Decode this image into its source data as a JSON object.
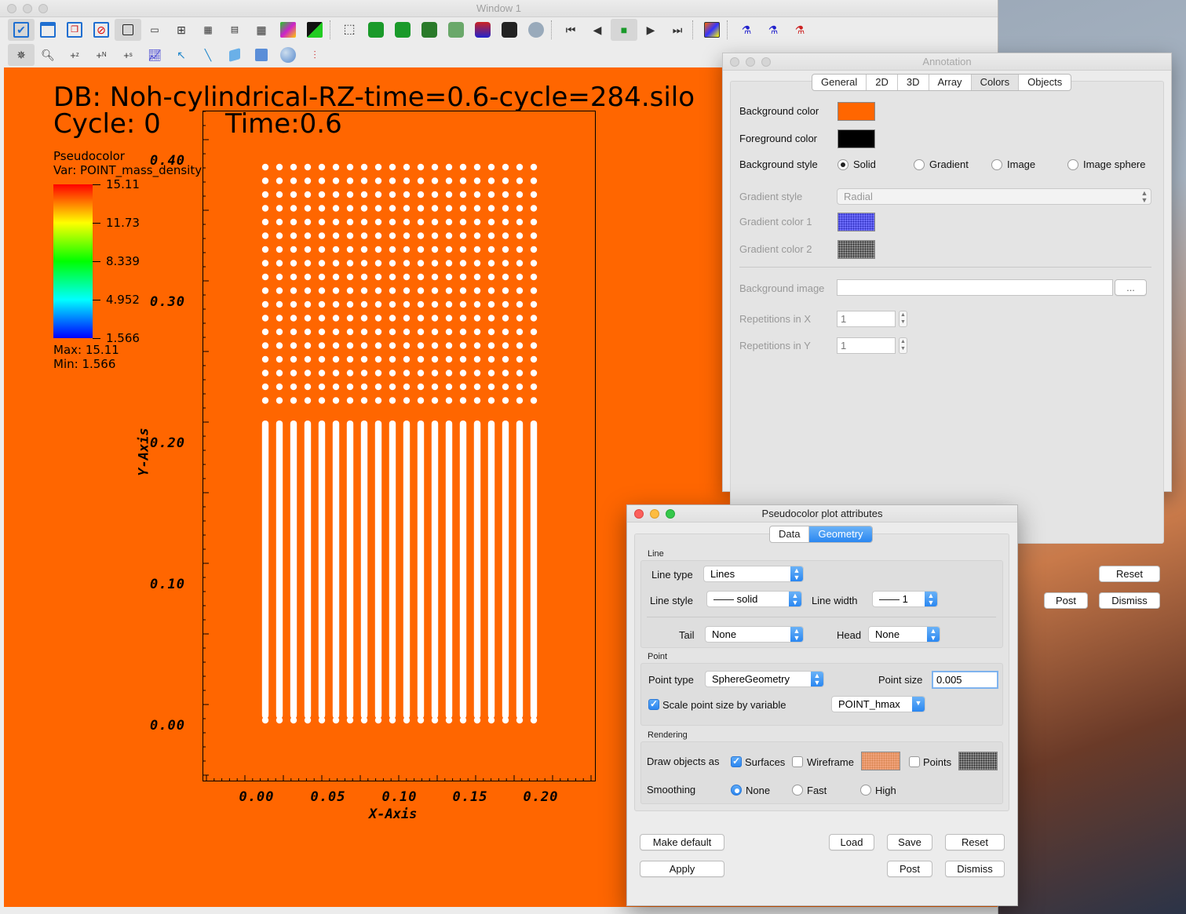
{
  "main_window": {
    "title": "Window 1",
    "toolbar1": [
      "check-doc-icon",
      "new-window-icon",
      "clone-window-icon",
      "delete-window-icon",
      "layout-1x1-icon",
      "layout-1x2-icon",
      "layout-2x2-icon",
      "layout-2x3-icon",
      "layout-2x4-icon",
      "layout-3x3-icon",
      "color-cube-icon",
      "lock-icon",
      "perspective-box-icon",
      "camera-1-icon",
      "camera-2-icon",
      "camera-3-icon",
      "camera-4-icon",
      "camera-5-icon",
      "camera-6-icon",
      "globe-icon",
      "first-frame-icon",
      "prev-frame-icon",
      "stop-icon",
      "play-icon",
      "last-frame-icon",
      "image-icon",
      "spinner-icon",
      "spinner2-icon",
      "spinner3-icon"
    ],
    "toolbar2": [
      "navigate-icon",
      "zoom-icon",
      "zone-pick-icon",
      "node-pick-icon",
      "spreadsheet-pick-icon",
      "lineout-icon",
      "pick-arrow-icon",
      "line-icon",
      "plane-icon",
      "box-icon",
      "sphere-icon",
      "sliders-icon"
    ]
  },
  "viz": {
    "db_title": "DB: Noh-cylindrical-RZ-time=0.6-cycle=284.silo",
    "cycle": "Cycle: 0",
    "time": "Time:0.6",
    "legend": {
      "name": "Pseudocolor",
      "var": "Var: POINT_mass_density",
      "values": [
        "15.11",
        "11.73",
        "8.339",
        "4.952",
        "1.566"
      ],
      "max": "Max:  15.11",
      "min": "Min:  1.566"
    },
    "y_ticks": [
      "0.40",
      "0.30",
      "0.20",
      "0.10",
      "0.00"
    ],
    "x_ticks": [
      "0.00",
      "0.05",
      "0.10",
      "0.15",
      "0.20"
    ],
    "y_axis_title": "Y-Axis",
    "x_axis_title": "X-Axis",
    "background_color": "#ff6600"
  },
  "annotation": {
    "title": "Annotation",
    "tabs": [
      "General",
      "2D",
      "3D",
      "Array",
      "Colors",
      "Objects"
    ],
    "active_tab": "Colors",
    "background_color_label": "Background color",
    "foreground_color_label": "Foreground color",
    "background_style_label": "Background style",
    "style_options": [
      "Solid",
      "Gradient",
      "Image",
      "Image sphere"
    ],
    "gradient_style_label": "Gradient style",
    "gradient_style_value": "Radial",
    "gradient_color1_label": "Gradient color 1",
    "gradient_color2_label": "Gradient color 2",
    "background_image_label": "Background image",
    "browse_label": "...",
    "rep_x_label": "Repetitions in X",
    "rep_x_value": "1",
    "rep_y_label": "Repetitions in Y",
    "rep_y_value": "1",
    "reset_label": "Reset",
    "post_label": "Post",
    "dismiss_label": "Dismiss",
    "background_color": "#ff6600",
    "foreground_color": "#000000"
  },
  "pseudocolor": {
    "title": "Pseudocolor plot attributes",
    "tabs": [
      "Data",
      "Geometry"
    ],
    "active_tab": "Geometry",
    "line_group": "Line",
    "line_type_label": "Line type",
    "line_type_value": "Lines",
    "line_style_label": "Line style",
    "line_style_value": "—— solid",
    "line_width_label": "Line width",
    "line_width_value": "—— 1",
    "tail_label": "Tail",
    "tail_value": "None",
    "head_label": "Head",
    "head_value": "None",
    "point_group": "Point",
    "point_type_label": "Point type",
    "point_type_value": "SphereGeometry",
    "point_size_label": "Point size",
    "point_size_value": "0.005",
    "scale_label": "Scale point size by variable",
    "scale_var": "POINT_hmax",
    "rendering_group": "Rendering",
    "draw_as_label": "Draw objects as",
    "surfaces_label": "Surfaces",
    "wireframe_label": "Wireframe",
    "points_label": "Points",
    "smoothing_label": "Smoothing",
    "smoothing_options": [
      "None",
      "Fast",
      "High"
    ],
    "make_default_label": "Make default",
    "load_label": "Load",
    "save_label": "Save",
    "reset_label": "Reset",
    "apply_label": "Apply",
    "post_label": "Post",
    "dismiss_label": "Dismiss"
  }
}
